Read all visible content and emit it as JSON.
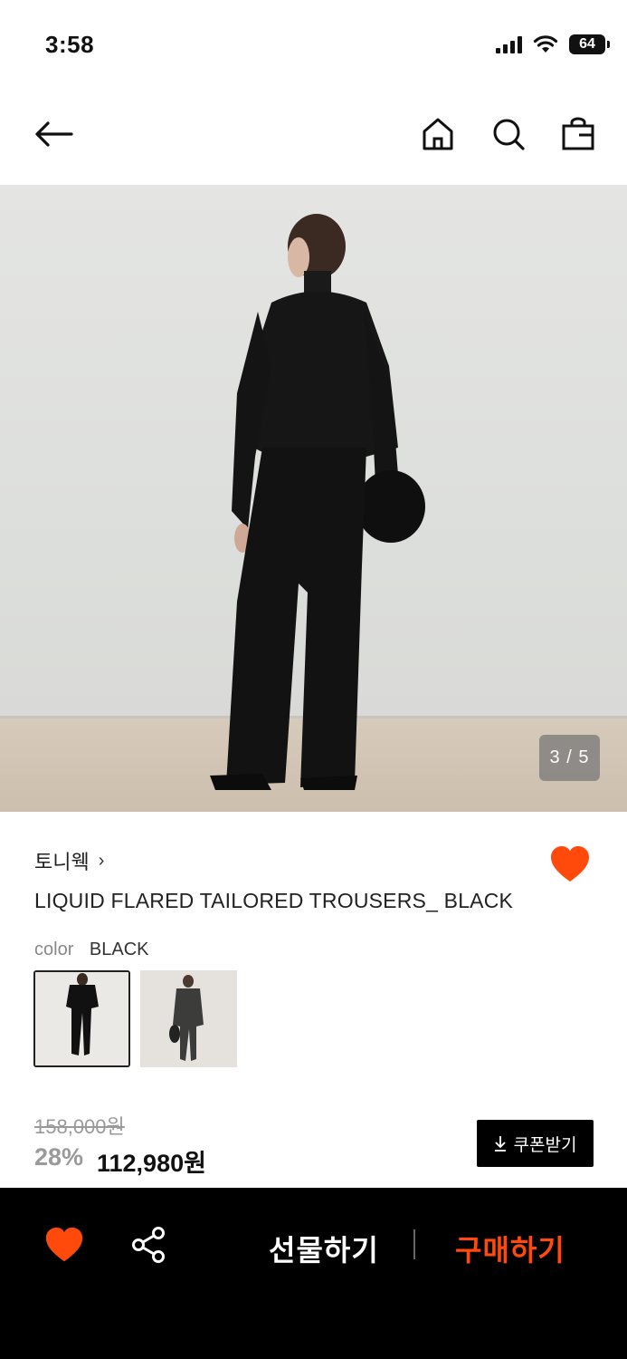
{
  "status_bar": {
    "time": "3:58",
    "battery": "64"
  },
  "nav": {
    "icons": [
      "back-arrow-icon",
      "home-icon",
      "search-icon",
      "shopping-bag-icon"
    ]
  },
  "gallery": {
    "counter": "3 / 5"
  },
  "product": {
    "brand": "토니웩",
    "brand_chevron": "›",
    "title": "LIQUID FLARED TAILORED TROUSERS_ BLACK",
    "color_label": "color",
    "color_value": "BLACK",
    "wished": true
  },
  "price": {
    "original": "158,000원",
    "discount": "28%",
    "sale": "112,980원",
    "coupon_label": "쿠폰받기"
  },
  "bottom_bar": {
    "gift_label": "선물하기",
    "buy_label": "구매하기"
  },
  "colors": {
    "accent": "#ff4a0c",
    "dark": "#000000"
  }
}
